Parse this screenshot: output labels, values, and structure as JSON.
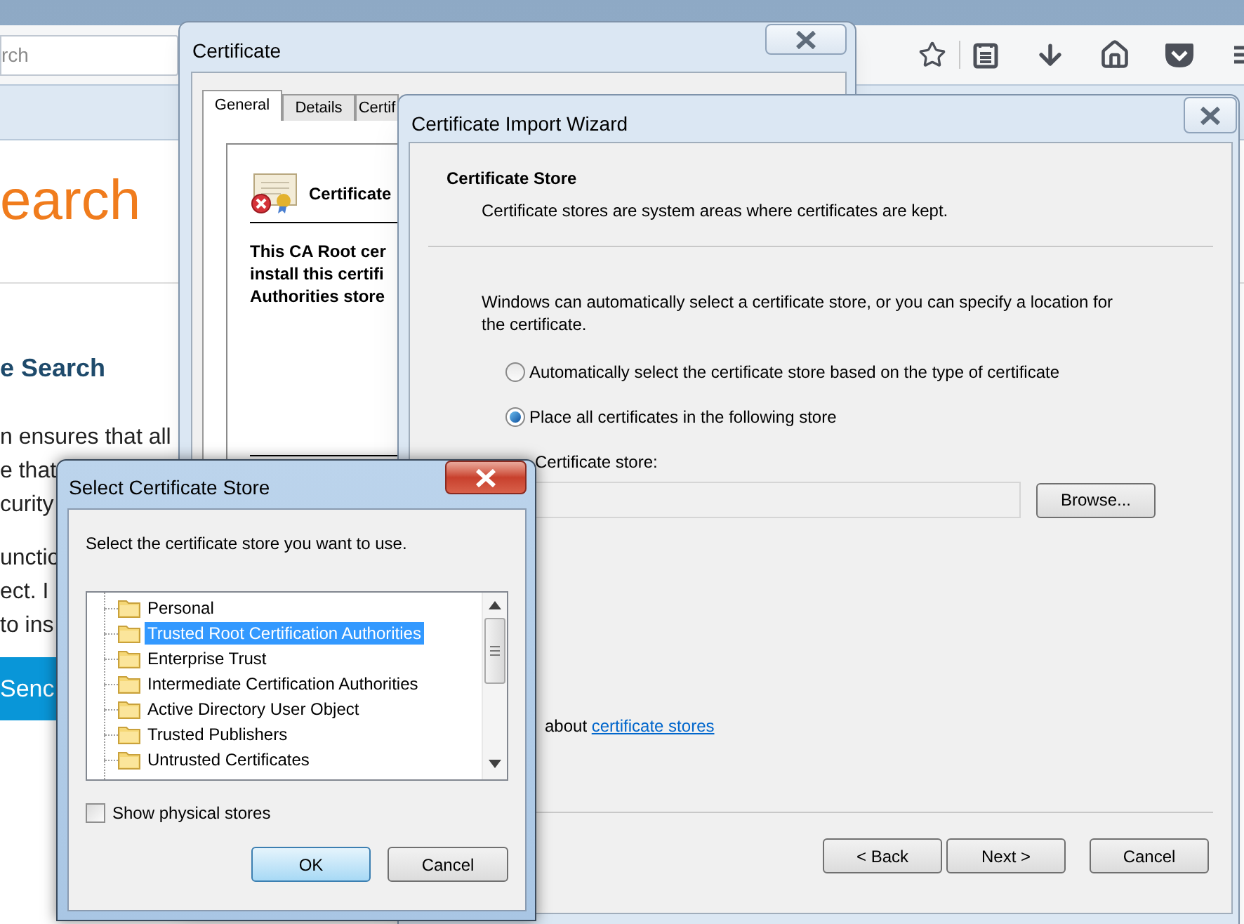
{
  "browser": {
    "search_placeholder": "rch",
    "page": {
      "logo_text": "earch",
      "heading": "e Search",
      "lines": [
        "n ensures that all",
        "e that",
        "curity"
      ],
      "lines_2": [
        "unctio",
        "ect. I",
        "to ins"
      ],
      "button": "Senc"
    }
  },
  "certificate_window": {
    "title": "Certificate",
    "tabs": [
      {
        "label": "General",
        "selected": true
      },
      {
        "label": "Details",
        "selected": false
      },
      {
        "label": "Certif",
        "selected": false
      }
    ],
    "header": "Certificate",
    "description_lines": [
      "This CA Root cer",
      "install this certifi",
      "Authorities store"
    ]
  },
  "wizard": {
    "title": "Certificate Import Wizard",
    "heading": "Certificate Store",
    "subheading": "Certificate stores are system areas where certificates are kept.",
    "intro": "Windows can automatically select a certificate store, or you can specify a location for the certificate.",
    "options": [
      {
        "label": "Automatically select the certificate store based on the type of certificate",
        "selected": false
      },
      {
        "label": "Place all certificates in the following store",
        "selected": true
      }
    ],
    "store_label": "Certificate store:",
    "browse": "Browse...",
    "learn_more_prefix": "about",
    "learn_more_link": "certificate stores",
    "buttons": [
      "< Back",
      "Next >",
      "Cancel"
    ]
  },
  "select_store": {
    "title": "Select Certificate Store",
    "prompt": "Select the certificate store you want to use.",
    "stores": [
      {
        "label": "Personal",
        "selected": false
      },
      {
        "label": "Trusted Root Certification Authorities",
        "selected": true
      },
      {
        "label": "Enterprise Trust",
        "selected": false
      },
      {
        "label": "Intermediate Certification Authorities",
        "selected": false
      },
      {
        "label": "Active Directory User Object",
        "selected": false
      },
      {
        "label": "Trusted Publishers",
        "selected": false
      },
      {
        "label": "Untrusted Certificates",
        "selected": false
      }
    ],
    "show_physical": {
      "label": "Show physical stores",
      "checked": false
    },
    "buttons": [
      "OK",
      "Cancel"
    ]
  }
}
